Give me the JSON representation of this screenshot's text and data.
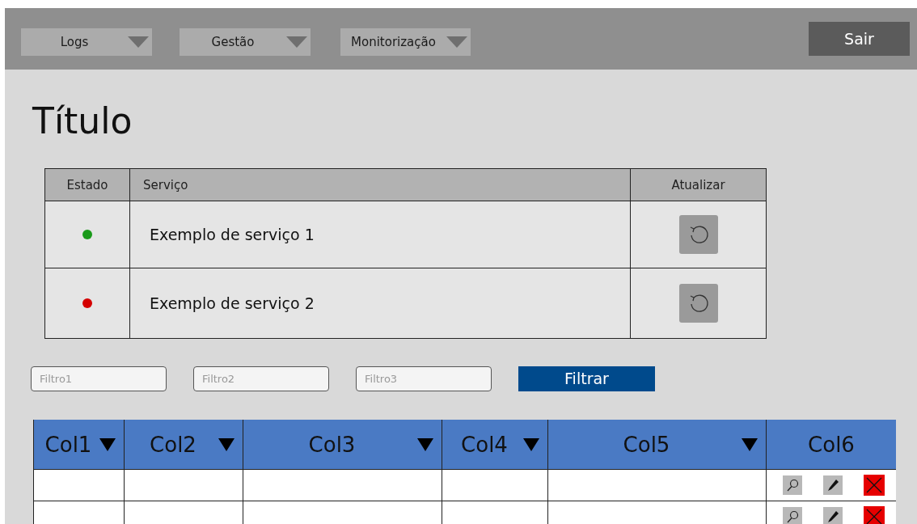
{
  "menus": [
    {
      "label": "Logs"
    },
    {
      "label": "Gestão"
    },
    {
      "label": "Monitorização"
    }
  ],
  "logout": {
    "label": "Sair"
  },
  "title": "Título",
  "services": {
    "columns": [
      "Estado",
      "Serviço",
      "Atualizar"
    ],
    "rows": [
      {
        "color": "#1a9a1a",
        "name": "Exemplo de serviço 1"
      },
      {
        "color": "#d40000",
        "name": "Exemplo de serviço 2"
      }
    ]
  },
  "filters": [
    {
      "placeholder": "Filtro1"
    },
    {
      "placeholder": "Filtro2"
    },
    {
      "placeholder": "Filtro3"
    }
  ],
  "filter_button": {
    "label": "Filtrar"
  },
  "table": {
    "columns": [
      {
        "label": "Col1",
        "sortable": true
      },
      {
        "label": "Col2",
        "sortable": true
      },
      {
        "label": "Col3",
        "sortable": true
      },
      {
        "label": "Col4",
        "sortable": true
      },
      {
        "label": "Col5",
        "sortable": true
      },
      {
        "label": "Col6",
        "sortable": false
      }
    ],
    "rows": [
      {
        "actions": [
          {
            "kind": "view"
          },
          {
            "kind": "edit"
          },
          {
            "kind": "delete"
          }
        ]
      },
      {
        "actions": [
          {
            "kind": "view"
          },
          {
            "kind": "edit"
          },
          {
            "kind": "delete"
          }
        ]
      }
    ]
  }
}
